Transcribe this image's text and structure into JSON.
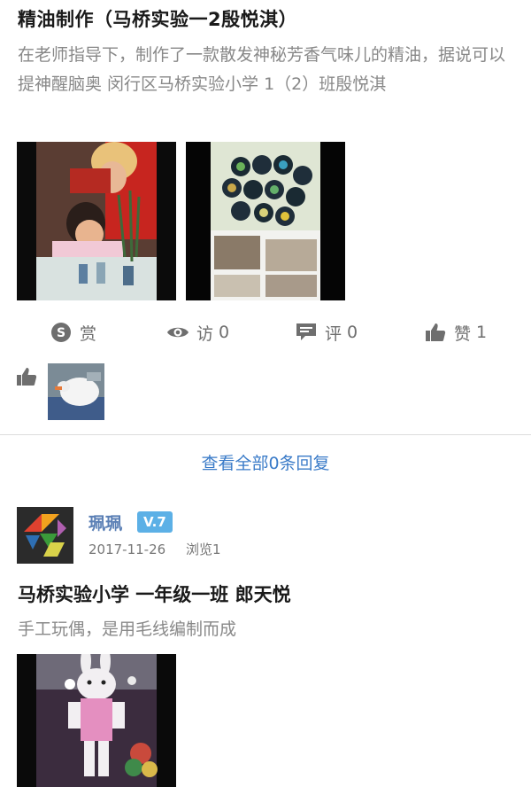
{
  "post1": {
    "title": "精油制作（马桥实验一2殷悦淇）",
    "description": "在老师指导下，制作了一款散发神秘芳香气味儿的精油，据说可以提神醒脑奥 闵行区马桥实验小学 1（2）班殷悦淇",
    "actions": {
      "reward_label": "赏",
      "views_label": "访",
      "views_count": "0",
      "comments_label": "评",
      "comments_count": "0",
      "likes_label": "赞",
      "likes_count": "1"
    },
    "view_all_replies": "查看全部0条回复"
  },
  "post2": {
    "author_name": "珮珮",
    "level": "V.7",
    "date": "2017-11-26",
    "views": "浏览1",
    "title": "马桥实验小学 一年级一班 郎天悦",
    "description": "手工玩偶，是用毛线编制而成"
  },
  "colors": {
    "link": "#3a7bc8",
    "badge": "#5cb0e6",
    "author": "#5a7fb5",
    "secondary_text": "#888888",
    "icon": "#6e6e6e"
  },
  "icons": [
    "skype-icon",
    "eye-icon",
    "comment-icon",
    "thumbs-up-icon"
  ]
}
